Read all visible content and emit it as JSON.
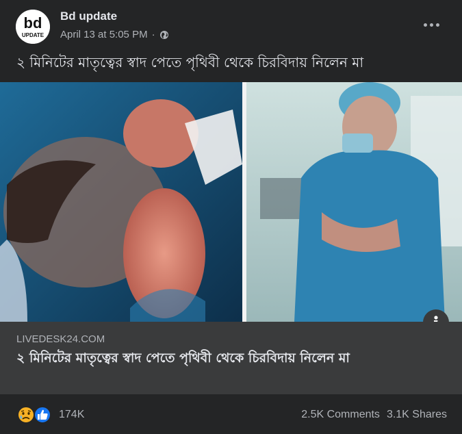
{
  "post": {
    "page_name": "Bd update",
    "avatar_top": "bd",
    "avatar_bottom": "UPDATE",
    "timestamp": "April 13 at 5:05 PM",
    "separator": "·",
    "audience_icon": "globe-icon",
    "more_icon": "more-options-icon",
    "text": "২ মিনিটের মাতৃত্বের স্বাদ পেতে পৃথিবী থেকে চিরবিদায় নিলেন মা"
  },
  "media": {
    "info_icon": "info-icon"
  },
  "link": {
    "domain": "LIVEDESK24.COM",
    "title": "২ মিনিটের মাতৃত্বের স্বাদ পেতে পৃথিবী থেকে চিরবিদায় নিলেন মা"
  },
  "engagement": {
    "reaction_icons": [
      "sad-reaction-icon",
      "like-reaction-icon"
    ],
    "reaction_count": "174K",
    "comments": "2.5K Comments",
    "shares": "3.1K Shares"
  },
  "colors": {
    "background": "#242526",
    "link_box": "#3a3b3c",
    "primary_text": "#e4e6eb",
    "secondary_text": "#b0b3b8",
    "like_blue": "#1877f2",
    "sad_yellow": "#f7b125"
  }
}
